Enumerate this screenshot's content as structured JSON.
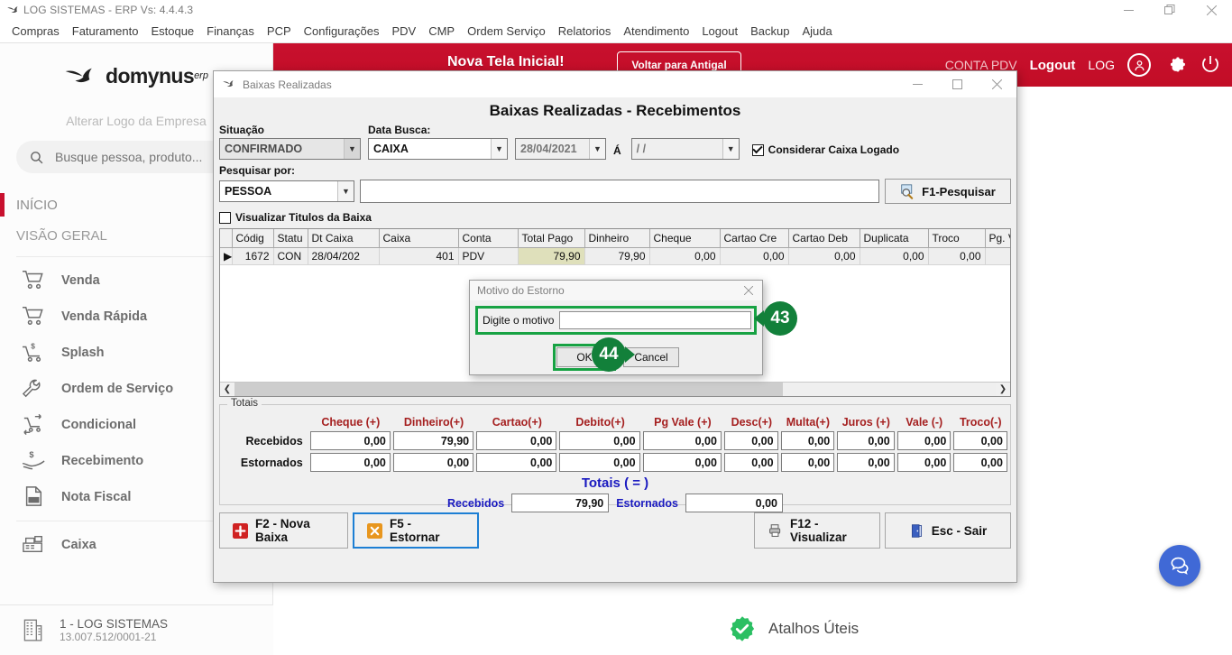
{
  "os": {
    "title": "LOG SISTEMAS - ERP Vs: 4.4.4.3",
    "app_icon": "domynus-bird-icon",
    "minimize": "minimize-icon",
    "maximize": "restore-icon",
    "close": "close-icon"
  },
  "menubar": {
    "items": [
      {
        "label": "Compras"
      },
      {
        "label": "Faturamento"
      },
      {
        "label": "Estoque"
      },
      {
        "label": "Finanças"
      },
      {
        "label": "PCP"
      },
      {
        "label": "Configurações"
      },
      {
        "label": "PDV"
      },
      {
        "label": "CMP"
      },
      {
        "label": "Ordem Serviço"
      },
      {
        "label": "Relatorios"
      },
      {
        "label": "Atendimento"
      },
      {
        "label": "Logout"
      },
      {
        "label": "Backup"
      },
      {
        "label": "Ajuda"
      }
    ]
  },
  "ribbon": {
    "headline": "Nova Tela Inicial!",
    "back_button": "Voltar para Antigal",
    "conta_pdv": "CONTA PDV",
    "logout": "Logout",
    "log": "LOG",
    "user_icon": "user-avatar-icon",
    "settings_icon": "gear-icon",
    "power_icon": "power-icon",
    "accent_color": "#c8102e"
  },
  "sidebar": {
    "brand": "domynus",
    "brand_sup": "erp",
    "alter_logo": "Alterar Logo da Empresa",
    "search_placeholder": "Busque pessoa, produto...",
    "search_value": "",
    "nav_inicio": "INÍCIO",
    "nav_visao_geral": "VISÃO GERAL",
    "items": [
      {
        "label": "Venda",
        "icon": "cart-icon"
      },
      {
        "label": "Venda Rápida",
        "icon": "cart-icon"
      },
      {
        "label": "Splash",
        "icon": "cart-money-icon"
      },
      {
        "label": "Ordem de Serviço",
        "icon": "wrench-icon"
      },
      {
        "label": "Condicional",
        "icon": "cart-arrow-icon"
      },
      {
        "label": "Recebimento",
        "icon": "hand-money-icon"
      },
      {
        "label": "Nota Fiscal",
        "icon": "nfce-document-icon"
      },
      {
        "label": "Caixa",
        "icon": "cash-register-icon"
      }
    ],
    "company_name": "1 - LOG SISTEMAS",
    "company_cnpj": "13.007.512/0001-21",
    "company_icon": "building-icon"
  },
  "main": {
    "shortcuts_label": "Atalhos Úteis",
    "shortcuts_icon": "green-check-badge-icon",
    "chat_icon": "chat-bubbles-icon",
    "chat_color": "#4069d6"
  },
  "window": {
    "titlebar": "Baixas Realizadas",
    "icon": "domynus-bird-icon",
    "minimize": "minimize-icon",
    "maximize": "maximize-icon",
    "close": "close-icon",
    "heading": "Baixas Realizadas - Recebimentos",
    "filters": {
      "situacao_label": "Situação",
      "situacao_value": "CONFIRMADO",
      "data_busca_label": "Data Busca:",
      "data_busca_value": "CAIXA",
      "date_from": "28/04/2021",
      "date_sep": "Á",
      "date_to": "  /  /",
      "considerar_caixa_label": "Considerar Caixa Logado",
      "considerar_caixa_checked": true,
      "pesquisar_por_label": "Pesquisar por:",
      "pesquisar_por_value": "PESSOA",
      "search_value": "",
      "search_button": "F1-Pesquisar",
      "search_button_icon": "magnifier-icon",
      "visualizar_titulos_label": "Visualizar Titulos da Baixa",
      "visualizar_titulos_checked": false
    },
    "grid": {
      "columns": [
        "",
        "Códig",
        "Statu",
        "Dt Caixa",
        "Caixa",
        "Conta",
        "Total Pago",
        "Dinheiro",
        "Cheque",
        "Cartao Cre",
        "Cartao Deb",
        "Duplicata",
        "Troco",
        "Pg. Vale"
      ],
      "rows": [
        {
          "marker": "▶",
          "codigo": "1672",
          "status": "CON",
          "dt_caixa": "28/04/202",
          "caixa": "401",
          "conta": "PDV",
          "total_pago": "79,90",
          "dinheiro": "79,90",
          "cheque": "0,00",
          "cartao_cred": "0,00",
          "cartao_deb": "0,00",
          "duplicata": "0,00",
          "troco": "0,00",
          "pg_vale": ""
        }
      ],
      "scroll_left_icon": "chevron-left-icon",
      "scroll_right_icon": "chevron-right-icon"
    },
    "totais": {
      "caption": "Totais",
      "columns": [
        "Cheque (+)",
        "Dinheiro(+)",
        "Cartao(+)",
        "Debito(+)",
        "Pg Vale (+)",
        "Desc(+)",
        "Multa(+)",
        "Juros (+)",
        "Vale (-)",
        "Troco(-)"
      ],
      "rows": [
        {
          "label": "Recebidos",
          "values": [
            "0,00",
            "79,90",
            "0,00",
            "0,00",
            "0,00",
            "0,00",
            "0,00",
            "0,00",
            "0,00",
            "0,00"
          ]
        },
        {
          "label": "Estornados",
          "values": [
            "0,00",
            "0,00",
            "0,00",
            "0,00",
            "0,00",
            "0,00",
            "0,00",
            "0,00",
            "0,00",
            "0,00"
          ]
        }
      ],
      "sum_heading": "Totais ( = )",
      "sum_recebidos_label": "Recebidos",
      "sum_recebidos_value": "79,90",
      "sum_estornados_label": "Estornados",
      "sum_estornados_value": "0,00"
    },
    "footer": {
      "nova_baixa": "F2 - Nova Baixa",
      "nova_baixa_icon": "plus-red-icon",
      "estornar": "F5 - Estornar",
      "estornar_icon": "x-orange-icon",
      "visualizar": "F12 - Visualizar",
      "visualizar_icon": "printer-icon",
      "sair": "Esc - Sair",
      "sair_icon": "door-exit-icon"
    }
  },
  "modal": {
    "title": "Motivo do Estorno",
    "close_icon": "close-icon",
    "field_label": "Digite o motivo",
    "field_value": "",
    "field_placeholder": "",
    "ok": "OK",
    "cancel": "Cancel"
  },
  "callouts": [
    {
      "id": "43",
      "label": "43"
    },
    {
      "id": "44",
      "label": "44"
    }
  ],
  "colors": {
    "highlight_green": "#17a243",
    "callout_green": "#12803a",
    "brand_red": "#c8102e",
    "grid_highlight": "#dfe0bb",
    "totais_header_red": "#a52020",
    "totais_blue": "#1a1ac0"
  }
}
